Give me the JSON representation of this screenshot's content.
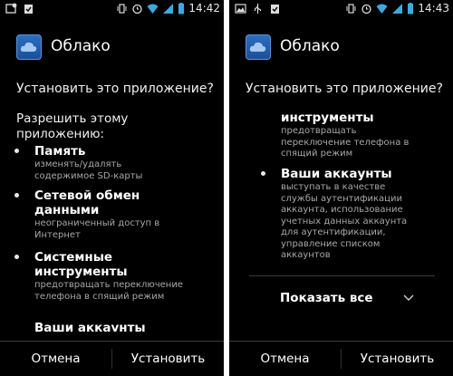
{
  "left": {
    "status": {
      "time": "14:42"
    },
    "app_title": "Облако",
    "question": "Установить это приложение?",
    "allow_text": "Разрешить этому приложению:",
    "permissions": [
      {
        "title": "Память",
        "desc": "изменять/удалять содержимое SD-карты"
      },
      {
        "title": "Сетевой обмен данными",
        "desc": "неограниченный доступ в Интернет"
      },
      {
        "title": "Системные инструменты",
        "desc": "предотвращать переключение телефона в спящий режим"
      },
      {
        "title": "Ваши аккаунты",
        "desc": ""
      }
    ],
    "buttons": {
      "cancel": "Отмена",
      "install": "Установить"
    }
  },
  "right": {
    "status": {
      "time": "14:43"
    },
    "app_title": "Облако",
    "question": "Установить это приложение?",
    "permissions": [
      {
        "title": "инструменты",
        "desc": "предотвращать переключение телефона в спящий режим"
      },
      {
        "title": "Ваши аккаунты",
        "desc": "выступать в качестве службы аутентификации аккаунта, использование учетных данных аккаунта для аутентификации, управление списком аккаунтов"
      }
    ],
    "show_all": "Показать все",
    "buttons": {
      "cancel": "Отмена",
      "install": "Установить"
    }
  },
  "colors": {
    "background": "#000000",
    "desc_text": "#a8a8a8",
    "divider": "#3a3a3a",
    "app_icon": "#2a6fc0"
  },
  "icons": [
    "notification-icon",
    "clipboard-check-icon",
    "vibrate-icon",
    "alarm-icon",
    "wifi-icon",
    "signal-icon",
    "battery-icon",
    "image-icon",
    "usb-icon",
    "cloud-icon",
    "chevron-down-icon"
  ]
}
